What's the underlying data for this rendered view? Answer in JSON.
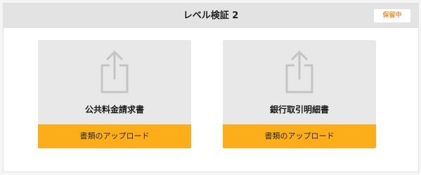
{
  "header": {
    "title": "レベル検証 2",
    "status_badge": "保留中",
    "status_color": "#f0922f"
  },
  "cards": [
    {
      "title": "公共料金請求書",
      "button_label": "書類のアップロード",
      "icon": "upload-icon"
    },
    {
      "title": "銀行取引明細書",
      "button_label": "書類のアップロード",
      "icon": "upload-icon"
    }
  ],
  "colors": {
    "accent": "#fbae18",
    "card_background": "#e8e8e8",
    "header_background": "#e3e3e3"
  }
}
